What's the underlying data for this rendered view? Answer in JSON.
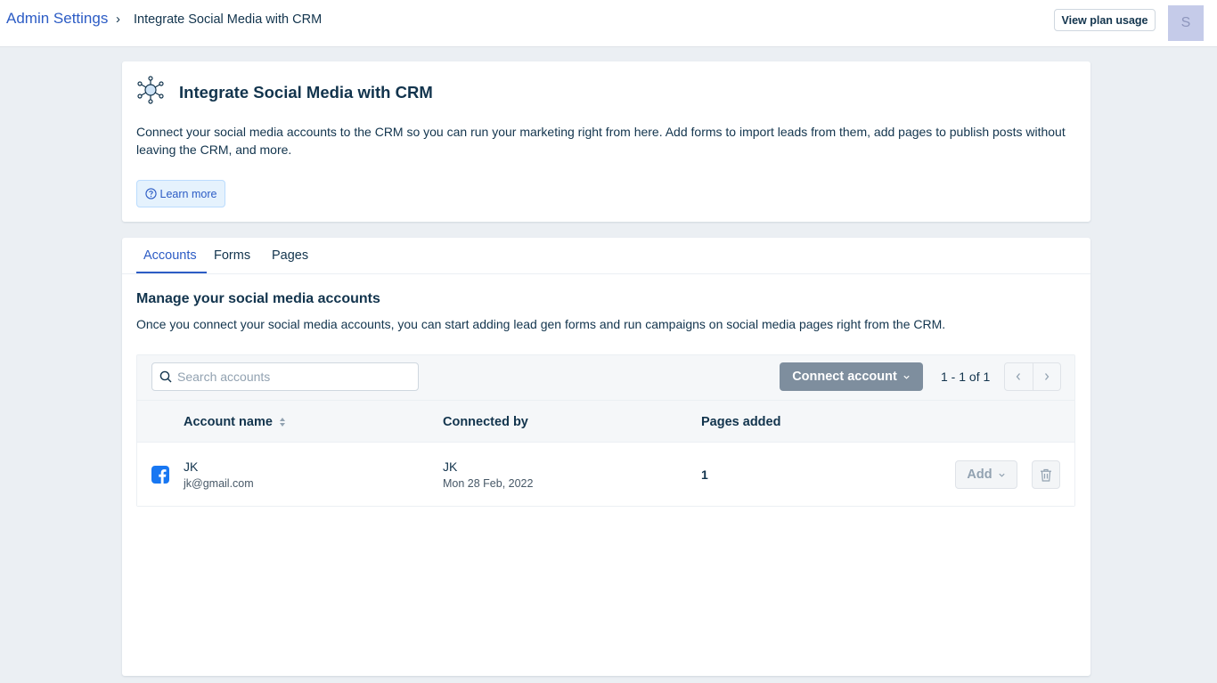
{
  "header": {
    "breadcrumb_root": "Admin Settings",
    "breadcrumb_separator": "›",
    "breadcrumb_current": "Integrate Social Media with CRM",
    "plan_button": "View plan usage",
    "avatar_initial": "S"
  },
  "intro": {
    "icon": "network-hub-icon",
    "title": "Integrate Social Media with CRM",
    "description": "Connect your social media accounts to the CRM so you can run your marketing right from here. Add forms to import leads from them, add pages to publish posts without leaving the CRM, and more.",
    "learn_more": "Learn more"
  },
  "tabs": [
    {
      "label": "Accounts",
      "active": true
    },
    {
      "label": "Forms",
      "active": false
    },
    {
      "label": "Pages",
      "active": false
    }
  ],
  "accounts": {
    "title": "Manage your social media accounts",
    "description": "Once you connect your social media accounts, you can start adding lead gen forms and run campaigns on social media pages right from the CRM.",
    "search_placeholder": "Search accounts",
    "connect_button": "Connect account",
    "pagination": "1 - 1 of 1",
    "columns": {
      "account_name": "Account name",
      "connected_by": "Connected by",
      "pages_added": "Pages added"
    },
    "rows": [
      {
        "platform_icon": "facebook-icon",
        "name": "JK",
        "email": "jk@gmail.com",
        "connected_by": "JK",
        "connected_on": "Mon 28 Feb, 2022",
        "pages_added": "1",
        "add_label": "Add"
      }
    ]
  },
  "colors": {
    "accent": "#2c5cc5",
    "text": "#12344d",
    "page_bg": "#ebeff3",
    "connect_bg": "#7e8e9e",
    "facebook": "#1877f2",
    "avatar_bg": "#c5cbe9"
  }
}
